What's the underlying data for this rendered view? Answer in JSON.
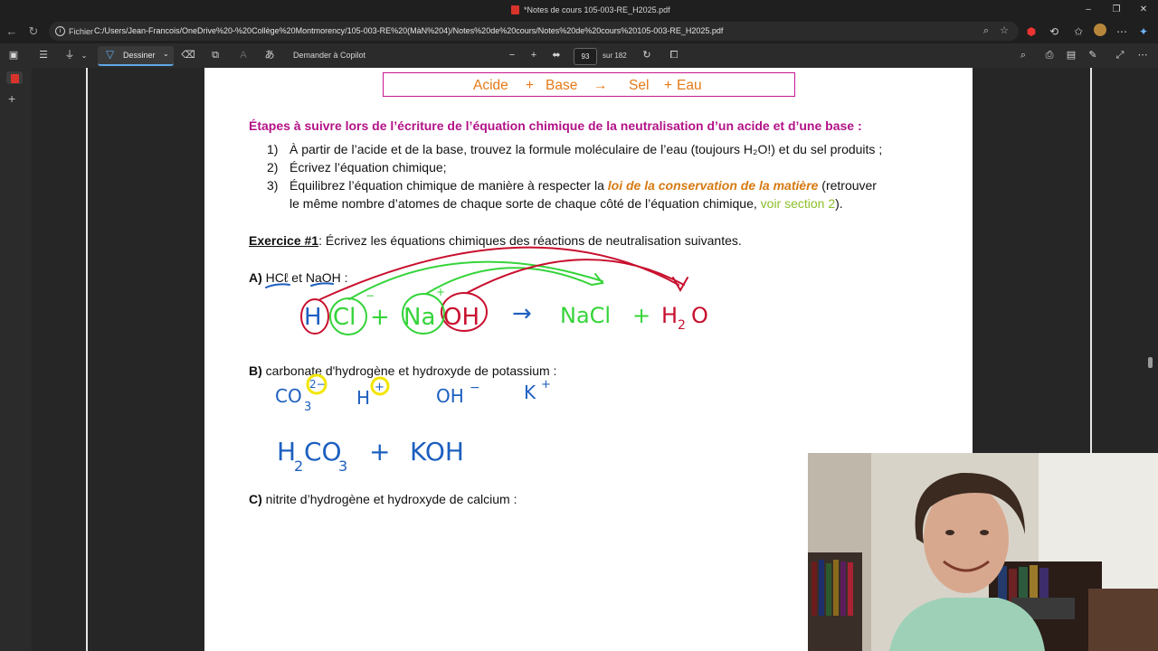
{
  "window": {
    "title": "*Notes de cours 105-003-RE_H2025.pdf",
    "minimize": "–",
    "restore": "❐",
    "close": "✕"
  },
  "address_bar": {
    "scheme_label": "Fichier",
    "url": "C:/Users/Jean-Francois/OneDrive%20-%20Collège%20Montmorency/105-003-RE%20(MàN%204)/Notes%20de%20cours/Notes%20de%20cours%20105-003-RE_H2025.pdf"
  },
  "pdf_toolbar": {
    "draw_label": "Dessiner",
    "copilot_label": "Demander à Copilot",
    "zoom_out": "−",
    "zoom_in": "+",
    "page_number": "93",
    "page_total": "sur 182"
  },
  "document": {
    "box": {
      "acid": "Acide",
      "plus1": "+",
      "base": "Base",
      "arrow": "→",
      "salt": "Sel",
      "plus2": "+",
      "water": "Eau"
    },
    "heading": "Étapes à suivre lors de l’écriture de l’équation chimique de la neutralisation d’un acide et d’une base :",
    "steps": [
      {
        "num": "1)",
        "text": "À partir de l’acide et de la base, trouvez la formule moléculaire de l’eau (toujours H₂O!) et du sel produits ;"
      },
      {
        "num": "2)",
        "text": "Écrivez l’équation chimique;"
      },
      {
        "num": "3)",
        "text_before": "Équilibrez l’équation chimique de manière à respecter la ",
        "emphasis": "loi de la conservation de la matière",
        "text_after": " (retrouver",
        "line2_before": "le même nombre d’atomes de chaque sorte de chaque côté de l’équation chimique, ",
        "link": "voir section 2",
        "line2_after": ")."
      }
    ],
    "exercise_title": "Exercice #1",
    "exercise_text": ": Écrivez les équations chimiques des réactions de neutralisation suivantes.",
    "part_a": {
      "label": "A)",
      "acid": "HCℓ",
      "et": " et ",
      "base": "NaOH",
      "colon": " :"
    },
    "part_b": {
      "label": "B)",
      "text": " carbonate d'hydrogène et hydroxyde de potassium :"
    },
    "part_c": {
      "label": "C)",
      "text": " nitrite d’hydrogène et hydroxyde de calcium :"
    },
    "ink": {
      "a_equation": [
        "H",
        "Cl",
        "+",
        "Na",
        "OH",
        "→",
        "NaCl",
        "+",
        "H",
        "2",
        "O"
      ],
      "a_charges": [
        "−",
        "+"
      ],
      "b_ions": [
        "CO",
        "3",
        "2−",
        "H",
        "+",
        "OH",
        "−",
        "K",
        "+"
      ],
      "b_equation": [
        "H",
        "2",
        "CO",
        "3",
        "+",
        "KOH"
      ]
    }
  },
  "colors": {
    "heading": "#b31287",
    "box_border": "#c8168e",
    "box_text": "#e47a18",
    "emphasis": "#d67a12",
    "link": "#8cbf2a",
    "ink_red": "#c8102e",
    "ink_green": "#35d43a",
    "ink_blue": "#1d5fbf",
    "ink_yellow": "#f2e600"
  }
}
